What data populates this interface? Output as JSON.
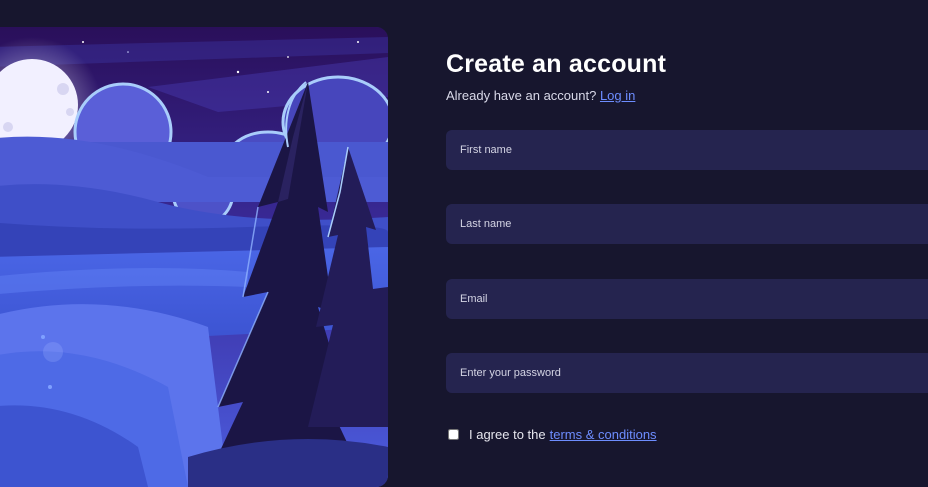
{
  "page": {
    "title": "Create an account",
    "login_prompt": "Already have an account?",
    "login_link": "Log in"
  },
  "form": {
    "first_name_placeholder": "First name",
    "last_name_placeholder": "Last name",
    "email_placeholder": "Email",
    "password_placeholder": "Enter your password",
    "agree_text": "I agree to the",
    "terms_link": "terms & conditions",
    "agree_checked": false
  },
  "colors": {
    "background": "#17162e",
    "input_background": "#25244f",
    "link": "#6d8dff"
  }
}
